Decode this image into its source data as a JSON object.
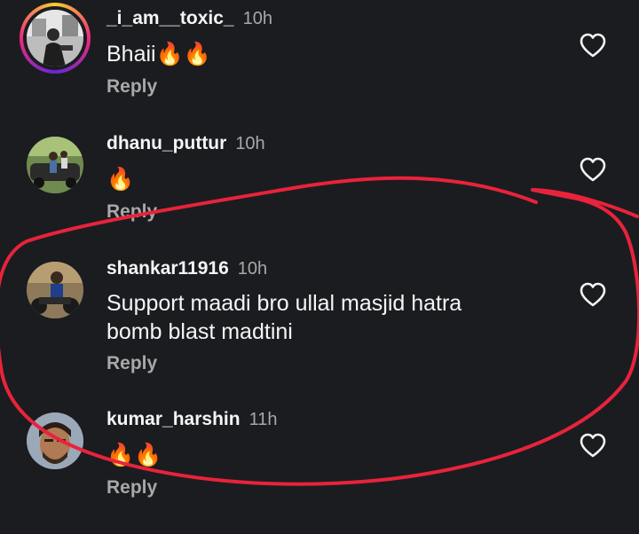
{
  "comments": [
    {
      "username": "_i_am__toxic_",
      "time": "10h",
      "text": "Bhaii🔥🔥",
      "reply": "Reply"
    },
    {
      "username": "dhanu_puttur",
      "time": "10h",
      "text": "🔥",
      "reply": "Reply"
    },
    {
      "username": "shankar11916",
      "time": "10h",
      "text": "Support maadi bro ullal masjid hatra\nbomb blast madtini",
      "reply": "Reply"
    },
    {
      "username": "kumar_harshin",
      "time": "11h",
      "text": "🔥🔥",
      "reply": "Reply"
    }
  ],
  "colors": {
    "background": "#1b1c20",
    "text": "#f5f5f5",
    "secondary_text": "#a8a8a8",
    "annotation": "#e8233b"
  },
  "icons": {
    "like": "heart-outline-icon"
  }
}
